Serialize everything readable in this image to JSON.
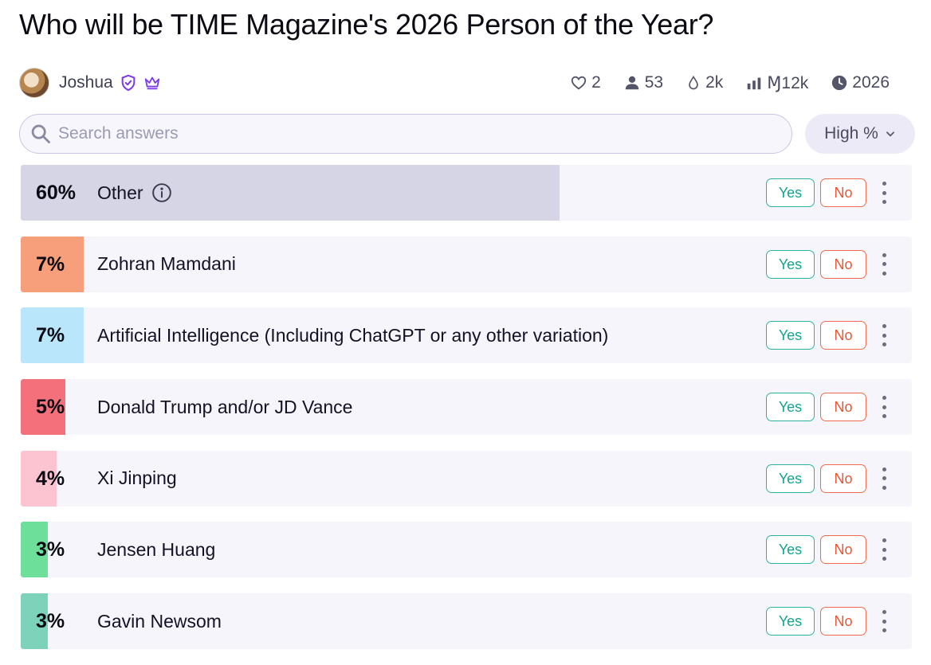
{
  "title": "Who will be TIME Magazine's 2026 Person of the Year?",
  "author": {
    "name": "Joshua",
    "badges": [
      "verified-shield-icon",
      "crown-icon"
    ]
  },
  "stats": {
    "likes": "2",
    "traders": "53",
    "liquidity": "2k",
    "volume": "Ɱ12k",
    "close": "2026"
  },
  "search": {
    "placeholder": "Search answers",
    "value": ""
  },
  "sort": {
    "label": "High %"
  },
  "answers": [
    {
      "pct": "60%",
      "prob": 0.6,
      "label": "Other",
      "color": "#d5d5e6",
      "info": true
    },
    {
      "pct": "7%",
      "prob": 0.07,
      "label": "Zohran Mamdani",
      "color": "#f79e7a"
    },
    {
      "pct": "7%",
      "prob": 0.07,
      "label": "Artificial Intelligence (Including ChatGPT or any other variation)",
      "color": "#b9e6fb"
    },
    {
      "pct": "5%",
      "prob": 0.05,
      "label": "Donald Trump and/or JD Vance",
      "color": "#f4717c"
    },
    {
      "pct": "4%",
      "prob": 0.04,
      "label": "Xi Jinping",
      "color": "#fcc4d0"
    },
    {
      "pct": "3%",
      "prob": 0.03,
      "label": "Jensen Huang",
      "color": "#6ddf9b"
    },
    {
      "pct": "3%",
      "prob": 0.03,
      "label": "Gavin Newsom",
      "color": "#7cd3b9"
    }
  ],
  "buttons": {
    "yes": "Yes",
    "no": "No"
  },
  "colors": {
    "yes": "#14a38f",
    "no": "#ea5533",
    "accent": "#7c3aed"
  }
}
